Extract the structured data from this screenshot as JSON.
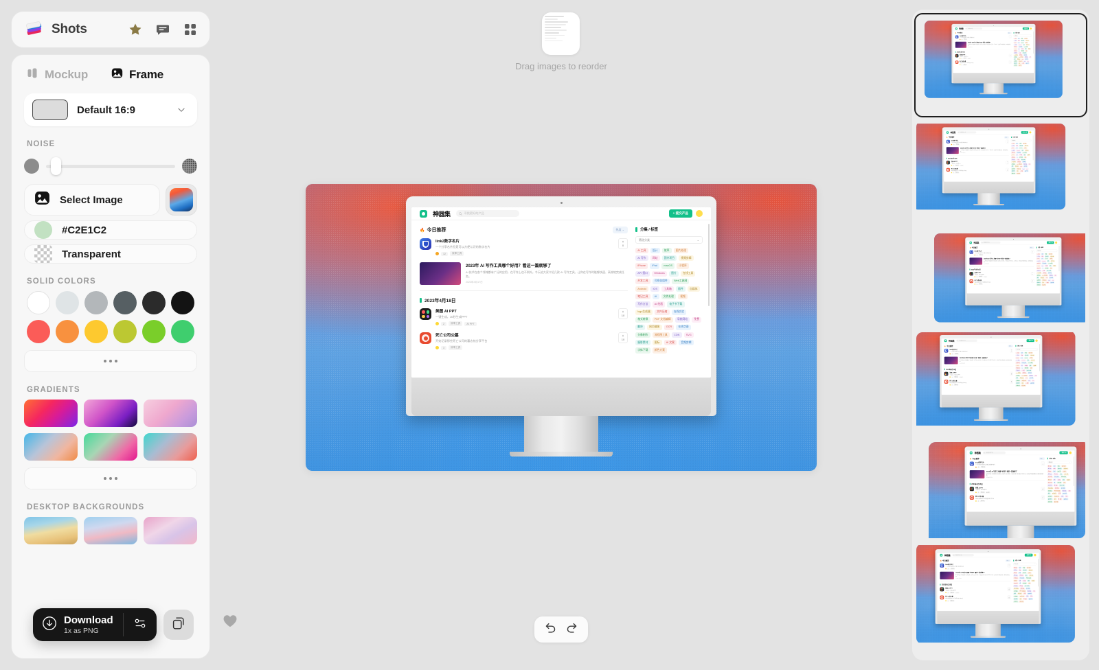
{
  "app": {
    "name": "Shots",
    "logo_icon": "shots-cards-logo",
    "header_icons": [
      "star-icon",
      "chat-icon",
      "grid-icon"
    ]
  },
  "sidebar": {
    "tabs": [
      {
        "label": "Mockup",
        "icon": "mockup-columns-icon",
        "active": false
      },
      {
        "label": "Frame",
        "icon": "frame-image-icon",
        "active": true
      }
    ],
    "ratio_select": {
      "label": "Default 16:9",
      "chevron_icon": "chevron-down-icon",
      "swatch_color": "#dcdcdc"
    },
    "noise": {
      "title": "NOISE",
      "left_icon": "plain-circle-icon",
      "right_icon": "grain-circle-icon",
      "value_percent": 4
    },
    "background_options": [
      {
        "label": "Select Image",
        "icon": "image-picker-icon",
        "type": "image"
      },
      {
        "label": "#C2E1C2",
        "icon": "color-circle-icon",
        "type": "color",
        "color": "#C2E1C2"
      },
      {
        "label": "Transparent",
        "icon": "checkerboard-icon",
        "type": "transparent"
      }
    ],
    "image_thumb_name": "current-image-thumbnail",
    "solid_colors": {
      "title": "SOLID COLORS",
      "swatches": [
        "#ffffff",
        "#dfe4e6",
        "#b3b7ba",
        "#565f63",
        "#2b2b2b",
        "#131313",
        "#fb5c58",
        "#f8913f",
        "#fdc92f",
        "#bcc832",
        "#7ace2a",
        "#3fce6e"
      ],
      "more_label": "•••"
    },
    "gradients": {
      "title": "GRADIENTS",
      "items": [
        {
          "name": "orange-magenta-violet",
          "css": "linear-gradient(135deg,#ff7034 0%,#f5275f 38%,#d61b9a 62%,#7c26e8 100%)"
        },
        {
          "name": "pink-purple-indigo",
          "css": "linear-gradient(135deg,#f2a8d8 0%,#d054c8 40%,#7a1fc4 72%,#140b3a 100%)"
        },
        {
          "name": "soft-pink-lilac",
          "css": "linear-gradient(135deg,#f6cfe0 0%,#efa8ce 45%,#c99bdc 75%,#a98fd6 100%)"
        },
        {
          "name": "blue-peach-orange",
          "css": "linear-gradient(135deg,#43b6e8 0%,#b9c4d8 40%,#f0b6a0 70%,#f08a45 100%)"
        },
        {
          "name": "green-mint-pink",
          "css": "linear-gradient(135deg,#45d99a 0%,#a8d6b4 38%,#ef69a6 72%,#e3178e 100%)"
        },
        {
          "name": "teal-rose-coral",
          "css": "linear-gradient(135deg,#3fd6cd 0%,#a9bcd2 38%,#e89b9b 70%,#ef5f4d 100%)"
        }
      ],
      "more_label": "•••"
    },
    "desktop_backgrounds": {
      "title": "DESKTOP BACKGROUNDS",
      "items": [
        {
          "name": "dunes-wallpaper",
          "css": "linear-gradient(170deg,#7fc4e8 0%,#a8d6e8 28%,#f0dca0 52%,#e8c27a 78%,#c9a25c 100%)"
        },
        {
          "name": "pastel-waves-wallpaper",
          "css": "linear-gradient(170deg,#9fd0ef 0%,#cfd8ef 35%,#f0b9c4 62%,#7fb8e0 100%)"
        },
        {
          "name": "watercolor-wallpaper",
          "css": "linear-gradient(150deg,#e8a3c8 0%,#f0d6e8 38%,#d8c4e8 62%,#f2b8c9 100%)"
        }
      ]
    }
  },
  "download_bar": {
    "icon": "download-circle-icon",
    "title": "Download",
    "subtitle": "1x as PNG",
    "options_icon": "sliders-icon",
    "copy_icon": "copy-stack-icon"
  },
  "canvas": {
    "reorder_hint": "Drag images to reorder",
    "reorder_thumb_name": "reorder-preview-thumbnail",
    "heart_icon": "heart-icon",
    "undo_icon": "undo-icon",
    "redo_icon": "redo-icon",
    "background": {
      "name": "red-blue-gradient-mesh",
      "colors": [
        "#ef5a3c",
        "#6e7fd0",
        "#3f93e0"
      ]
    }
  },
  "mockup": {
    "device": "imac",
    "site": {
      "logo_text": "神器集",
      "search_placeholder": "寻找更好的产品",
      "cta_label": "+ 提交产品",
      "avatar_name": "user-avatar",
      "today_section": {
        "title": "今日推荐",
        "fire_icon": "fire-icon",
        "filter_label": "热度 ⌄"
      },
      "products": [
        {
          "name": "link2数字名片",
          "desc": "一个分享名片但是可以方便认识的数字名片",
          "tags": [
            "效率工具"
          ],
          "votes": "0",
          "icon_color": "#2b4fc9"
        },
        {
          "name": "美图 AI PPT",
          "desc": "一键生成，10秒生成PPT",
          "tags": [
            "效率工具",
            "AI PPT"
          ],
          "votes": "10",
          "icon_color": "#1c1c1c"
        },
        {
          "name": "死亡公司公墓",
          "desc": "开始记录那些死亡公司的墓志铭分享平台",
          "tags": [
            "效率工具"
          ],
          "votes": "10",
          "icon_color": "#e84a2f"
        }
      ],
      "article": {
        "title": "2023年 AI 写作工具哪个好用？看这一篇就够了",
        "desc": "AI 技术在各个领域都有广泛的应用，在写作上也不例外。今天给大家介绍几款 AI 写作工具，让你在写作时能够快速、高效地完成任务。",
        "date": "2023年4月17日"
      },
      "date_divider": "2023年4月18日",
      "sidebar": {
        "title": "分集 / 标签",
        "select_label": "筛选分类",
        "tags": [
          "AI 工具",
          "设计",
          "效率",
          "图片处理",
          "AI 写作",
          "网站",
          "国外项目",
          "视频剪辑",
          "iPhone",
          "iPad",
          "macOS",
          "小程序",
          "API 接口",
          "Windows",
          "图片",
          "在线工具",
          "开发工具",
          "可视化组件",
          "Web工具网",
          "Android",
          "iOS",
          "工具箱",
          "插件",
          "自媒体",
          "笔记工具",
          "AI",
          "文件处理",
          "视频",
          "写作方法",
          "AI 绘画",
          "电子书下载",
          "logo生成器",
          "文件压缩",
          "在线实验",
          "格式转换",
          "PDF 文档编辑",
          "导航网站",
          "免费",
          "翻译",
          "网页截图",
          "OCR",
          "在线字幕",
          "头像制作",
          "流程图工具",
          "CDN",
          "SVG",
          "摄影素材",
          "图标",
          "AI 文案",
          "音频剪辑",
          "字体下载",
          "颜色方案"
        ]
      }
    }
  },
  "thumbnails": {
    "count": 6,
    "selected_index": 0,
    "items": [
      {
        "name": "export-variant-1",
        "selected": true
      },
      {
        "name": "export-variant-2",
        "selected": false
      },
      {
        "name": "export-variant-3",
        "selected": false
      },
      {
        "name": "export-variant-4",
        "selected": false
      },
      {
        "name": "export-variant-5",
        "selected": false
      },
      {
        "name": "export-variant-6",
        "selected": false
      }
    ]
  }
}
